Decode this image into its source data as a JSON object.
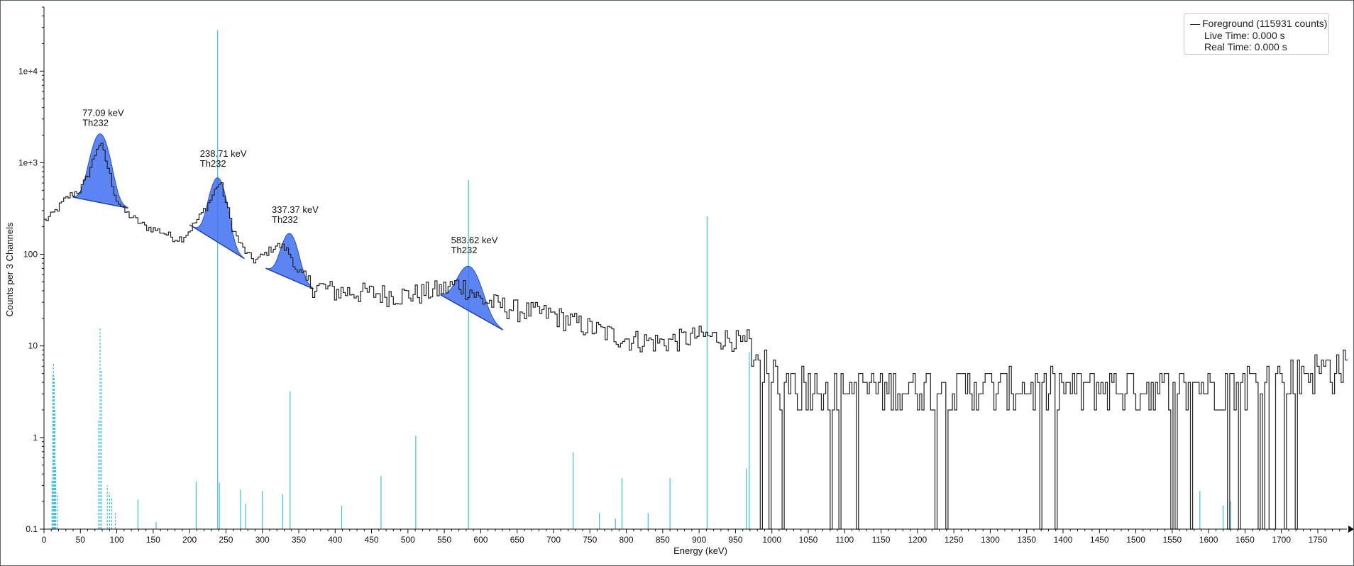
{
  "chart_data": {
    "type": "line",
    "xlabel": "Energy (keV)",
    "ylabel": "Counts per 3 Channels",
    "xlim": [
      0,
      1790
    ],
    "ylim": [
      0.1,
      50000
    ],
    "y_scale": "log",
    "x_ticks": [
      0,
      50,
      100,
      150,
      200,
      250,
      300,
      350,
      400,
      450,
      500,
      550,
      600,
      650,
      700,
      750,
      800,
      850,
      900,
      950,
      1000,
      1050,
      1100,
      1150,
      1200,
      1250,
      1300,
      1350,
      1400,
      1450,
      1500,
      1550,
      1600,
      1650,
      1700,
      1750
    ],
    "y_ticks": [
      {
        "value": 0.1,
        "label": "0.1"
      },
      {
        "value": 1,
        "label": "1"
      },
      {
        "value": 10,
        "label": "10"
      },
      {
        "value": 100,
        "label": "100"
      },
      {
        "value": 1000,
        "label": "1e+3"
      },
      {
        "value": 10000,
        "label": "1e+4"
      }
    ],
    "grid": false,
    "legend_position": "top-right",
    "legend": {
      "series_label": "Foreground (115931 counts)",
      "live_time": "Live Time: 0.000 s",
      "real_time": "Real Time: 0.000 s"
    },
    "colors": {
      "spectrum": "#222222",
      "peak_fill": "#3f6ef0",
      "reference_lines": "#3cc0ea"
    },
    "spectrum_shape": {
      "x": [
        0,
        10,
        20,
        30,
        40,
        50,
        60,
        70,
        75,
        80,
        90,
        100,
        110,
        120,
        140,
        160,
        180,
        190,
        200,
        215,
        230,
        240,
        245,
        250,
        260,
        270,
        280,
        290,
        300,
        310,
        320,
        330,
        335,
        340,
        350,
        360,
        380,
        400,
        450,
        500,
        550,
        570,
        585,
        600,
        650,
        700,
        750,
        800,
        850,
        900,
        950,
        963,
        1000,
        1100,
        1200,
        1300,
        1400,
        1500,
        1600,
        1700,
        1790
      ],
      "y": [
        230,
        260,
        320,
        400,
        460,
        500,
        700,
        1200,
        1600,
        1500,
        800,
        400,
        300,
        260,
        200,
        180,
        150,
        150,
        180,
        260,
        400,
        600,
        550,
        380,
        190,
        130,
        100,
        85,
        95,
        110,
        125,
        120,
        110,
        95,
        60,
        50,
        44,
        40,
        38,
        36,
        42,
        48,
        42,
        32,
        25,
        22,
        16,
        12,
        11,
        13,
        12,
        10,
        4,
        3,
        3,
        3,
        3,
        3,
        3,
        4,
        5
      ]
    },
    "peaks": [
      {
        "energy": 77.09,
        "label": "77.09 keV",
        "nuclide": "Th232",
        "height": 1700,
        "sigma": 11,
        "x_start": 40,
        "x_end": 115,
        "cont_start": 420,
        "cont_end": 320
      },
      {
        "energy": 238.71,
        "label": "238.71 keV",
        "nuclide": "Th232",
        "height": 550,
        "sigma": 10,
        "x_start": 200,
        "x_end": 275,
        "cont_start": 210,
        "cont_end": 90
      },
      {
        "energy": 337.37,
        "label": "337.37 keV",
        "nuclide": "Th232",
        "height": 115,
        "sigma": 10,
        "x_start": 305,
        "x_end": 370,
        "cont_start": 70,
        "cont_end": 42
      },
      {
        "energy": 583.62,
        "label": "583.62 keV",
        "nuclide": "Th232",
        "height": 50,
        "sigma": 14,
        "x_start": 545,
        "x_end": 630,
        "cont_start": 36,
        "cont_end": 15
      }
    ],
    "reference_lines": [
      {
        "energy": 12,
        "height": 4.8,
        "dashed": true
      },
      {
        "energy": 13,
        "height": 6.5,
        "dashed": true
      },
      {
        "energy": 14,
        "height": 4.5,
        "dashed": true
      },
      {
        "energy": 15,
        "height": 2.0,
        "dashed": true
      },
      {
        "energy": 16,
        "height": 0.5,
        "dashed": true
      },
      {
        "energy": 11,
        "height": 0.35,
        "dashed": true
      },
      {
        "energy": 18,
        "height": 0.25,
        "dashed": true
      },
      {
        "energy": 75,
        "height": 1.6,
        "dashed": true
      },
      {
        "energy": 77,
        "height": 16,
        "dashed": true
      },
      {
        "energy": 79,
        "height": 5.5,
        "dashed": true
      },
      {
        "energy": 87,
        "height": 0.3,
        "dashed": true
      },
      {
        "energy": 90,
        "height": 0.25,
        "dashed": true
      },
      {
        "energy": 93,
        "height": 0.22,
        "dashed": true
      },
      {
        "energy": 98,
        "height": 0.15,
        "dashed": true
      },
      {
        "energy": 129,
        "height": 0.21,
        "dashed": false
      },
      {
        "energy": 154,
        "height": 0.12,
        "dashed": false
      },
      {
        "energy": 209,
        "height": 0.33,
        "dashed": false
      },
      {
        "energy": 238.6,
        "height": 28000,
        "dashed": false
      },
      {
        "energy": 241,
        "height": 0.32,
        "dashed": false
      },
      {
        "energy": 270,
        "height": 0.27,
        "dashed": false
      },
      {
        "energy": 277,
        "height": 0.19,
        "dashed": false
      },
      {
        "energy": 300,
        "height": 0.26,
        "dashed": false
      },
      {
        "energy": 328,
        "height": 0.24,
        "dashed": false
      },
      {
        "energy": 338,
        "height": 3.2,
        "dashed": false
      },
      {
        "energy": 409,
        "height": 0.18,
        "dashed": false
      },
      {
        "energy": 463,
        "height": 0.38,
        "dashed": false
      },
      {
        "energy": 510.8,
        "height": 1.05,
        "dashed": false
      },
      {
        "energy": 583.2,
        "height": 650,
        "dashed": false
      },
      {
        "energy": 727,
        "height": 0.69,
        "dashed": false
      },
      {
        "energy": 763,
        "height": 0.15,
        "dashed": false
      },
      {
        "energy": 785,
        "height": 0.13,
        "dashed": false
      },
      {
        "energy": 794,
        "height": 0.36,
        "dashed": false
      },
      {
        "energy": 830,
        "height": 0.15,
        "dashed": false
      },
      {
        "energy": 860,
        "height": 0.36,
        "dashed": false
      },
      {
        "energy": 911,
        "height": 260,
        "dashed": false
      },
      {
        "energy": 965,
        "height": 0.46,
        "dashed": false
      },
      {
        "energy": 969,
        "height": 8.5,
        "dashed": false
      },
      {
        "energy": 1588,
        "height": 0.26,
        "dashed": false
      },
      {
        "energy": 1620,
        "height": 0.18,
        "dashed": false
      },
      {
        "energy": 1630,
        "height": 0.2,
        "dashed": false
      }
    ]
  }
}
